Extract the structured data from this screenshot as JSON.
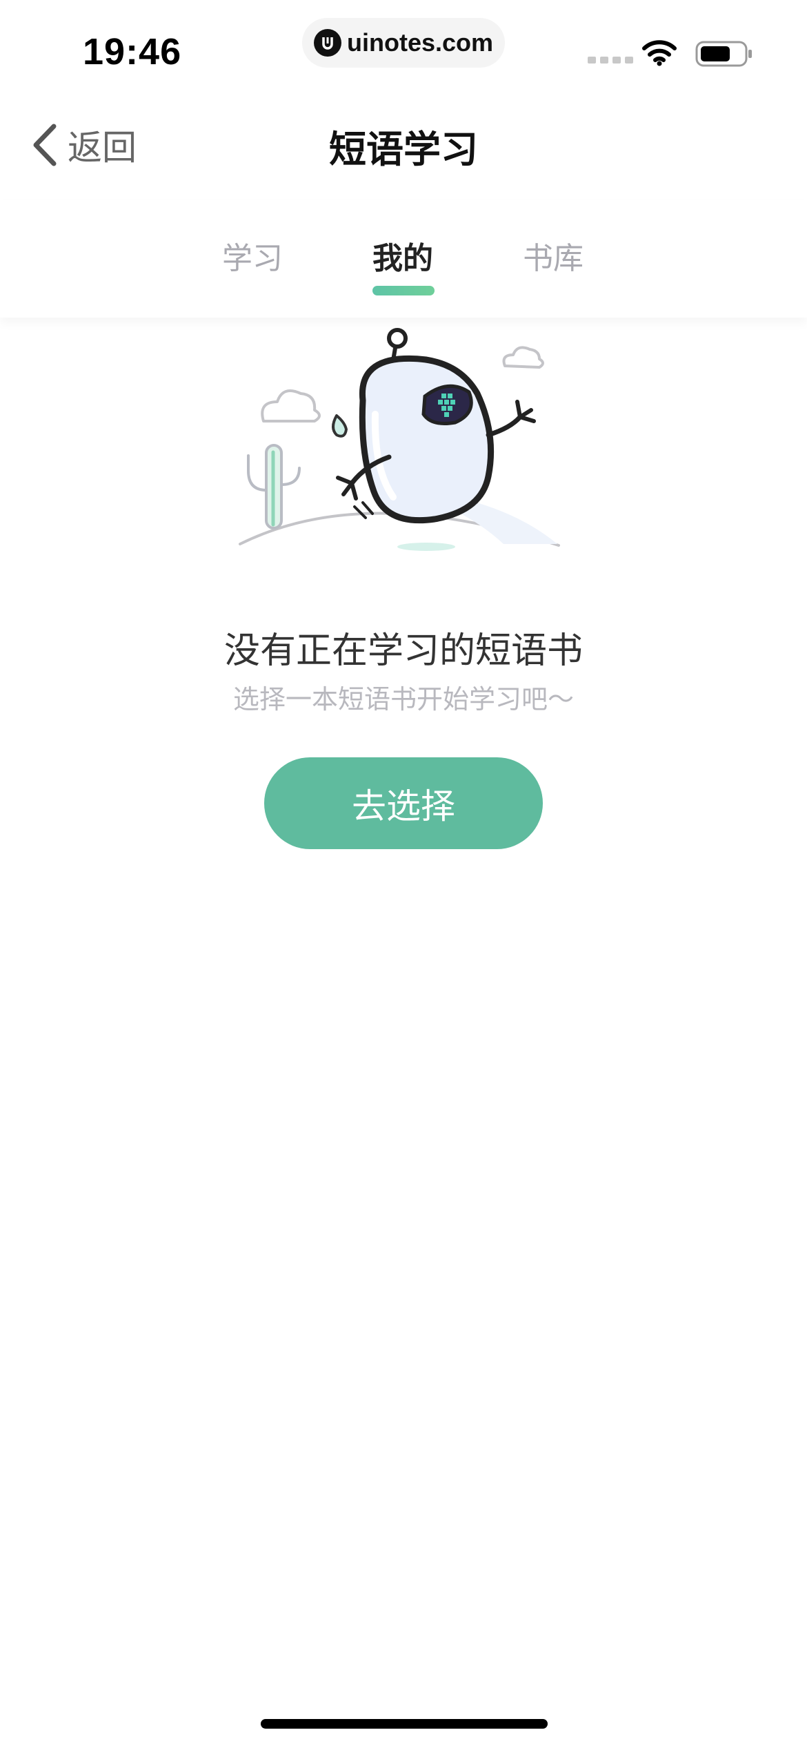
{
  "status_bar": {
    "time": "19:46",
    "url": "uinotes.com",
    "icons": [
      "cellular-signal-icon",
      "wifi-icon",
      "battery-icon"
    ]
  },
  "nav": {
    "back_label": "返回",
    "title": "短语学习"
  },
  "tabs": [
    {
      "label": "学习",
      "active": false
    },
    {
      "label": "我的",
      "active": true
    },
    {
      "label": "书库",
      "active": false
    }
  ],
  "empty_state": {
    "title": "没有正在学习的短语书",
    "subtitle": "选择一本短语书开始学习吧～",
    "button_label": "去选择"
  },
  "colors": {
    "accent": "#5fbb9e",
    "tab_active_text": "#222222",
    "tab_inactive_text": "#a9a9b0",
    "subtitle_text": "#b8b8be"
  }
}
